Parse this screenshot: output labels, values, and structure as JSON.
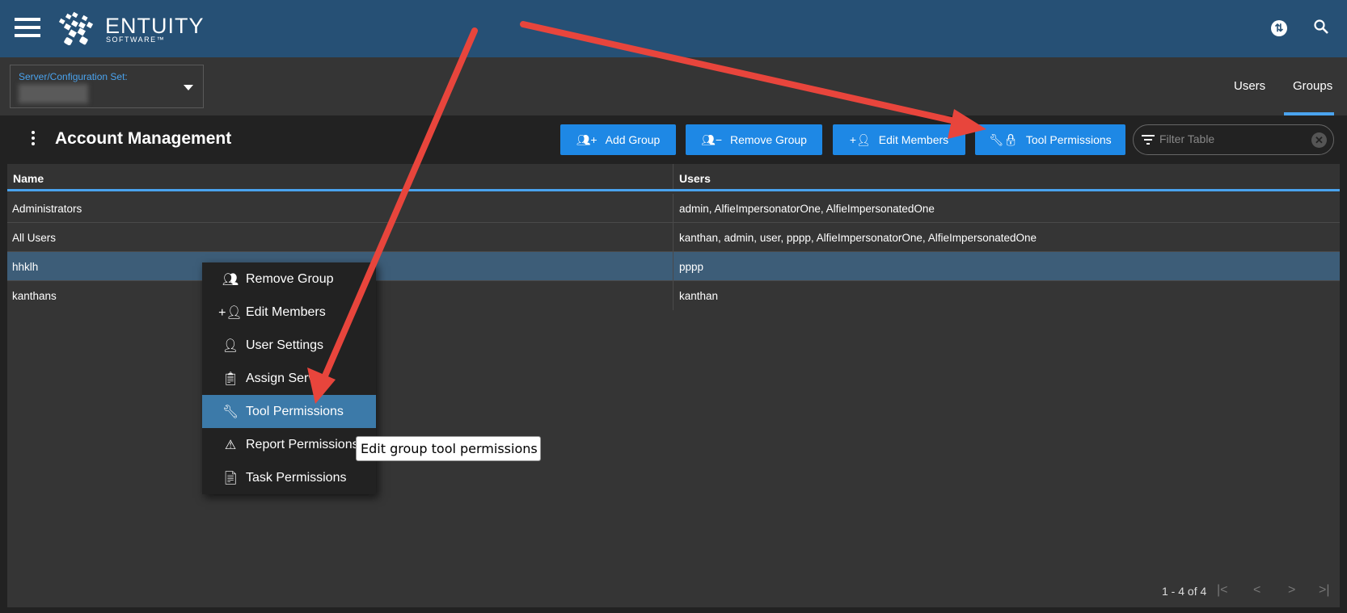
{
  "header": {
    "brand": "ENTUITY",
    "brand_sub": "SOFTWARE™",
    "icons": [
      "menu-icon",
      "sync-icon",
      "search-icon"
    ]
  },
  "server_select": {
    "label": "Server/Configuration Set:",
    "value": ""
  },
  "tabs": [
    {
      "label": "Users",
      "active": false
    },
    {
      "label": "Groups",
      "active": true
    }
  ],
  "page": {
    "title": "Account Management"
  },
  "toolbar": {
    "add_group": "Add Group",
    "remove_group": "Remove Group",
    "edit_members": "Edit Members",
    "tool_permissions": "Tool Permissions",
    "filter_placeholder": "Filter Table"
  },
  "table": {
    "columns": [
      "Name",
      "Users"
    ],
    "rows": [
      {
        "name": "Administrators",
        "users": "admin, AlfieImpersonatorOne, AlfieImpersonatedOne"
      },
      {
        "name": "All Users",
        "users": "kanthan, admin, user, pppp, AlfieImpersonatorOne, AlfieImpersonatedOne"
      },
      {
        "name": "hhklh",
        "users": "pppp",
        "selected": true
      },
      {
        "name": "kanthans",
        "users": "kanthan"
      }
    ],
    "pagination": "1 - 4 of 4"
  },
  "context_menu": {
    "items": [
      "Remove Group",
      "Edit Members",
      "User Settings",
      "Assign Server",
      "Tool Permissions",
      "Report Permissions",
      "Task Permissions"
    ],
    "highlighted": "Tool Permissions"
  },
  "tooltip": "Edit group tool permissions",
  "colors": {
    "header": "#265075",
    "accent": "#1e88e5",
    "selected_row": "#3d5d78",
    "menu_highlight": "#3c7aa9",
    "annotation_arrow": "#e8453c"
  }
}
